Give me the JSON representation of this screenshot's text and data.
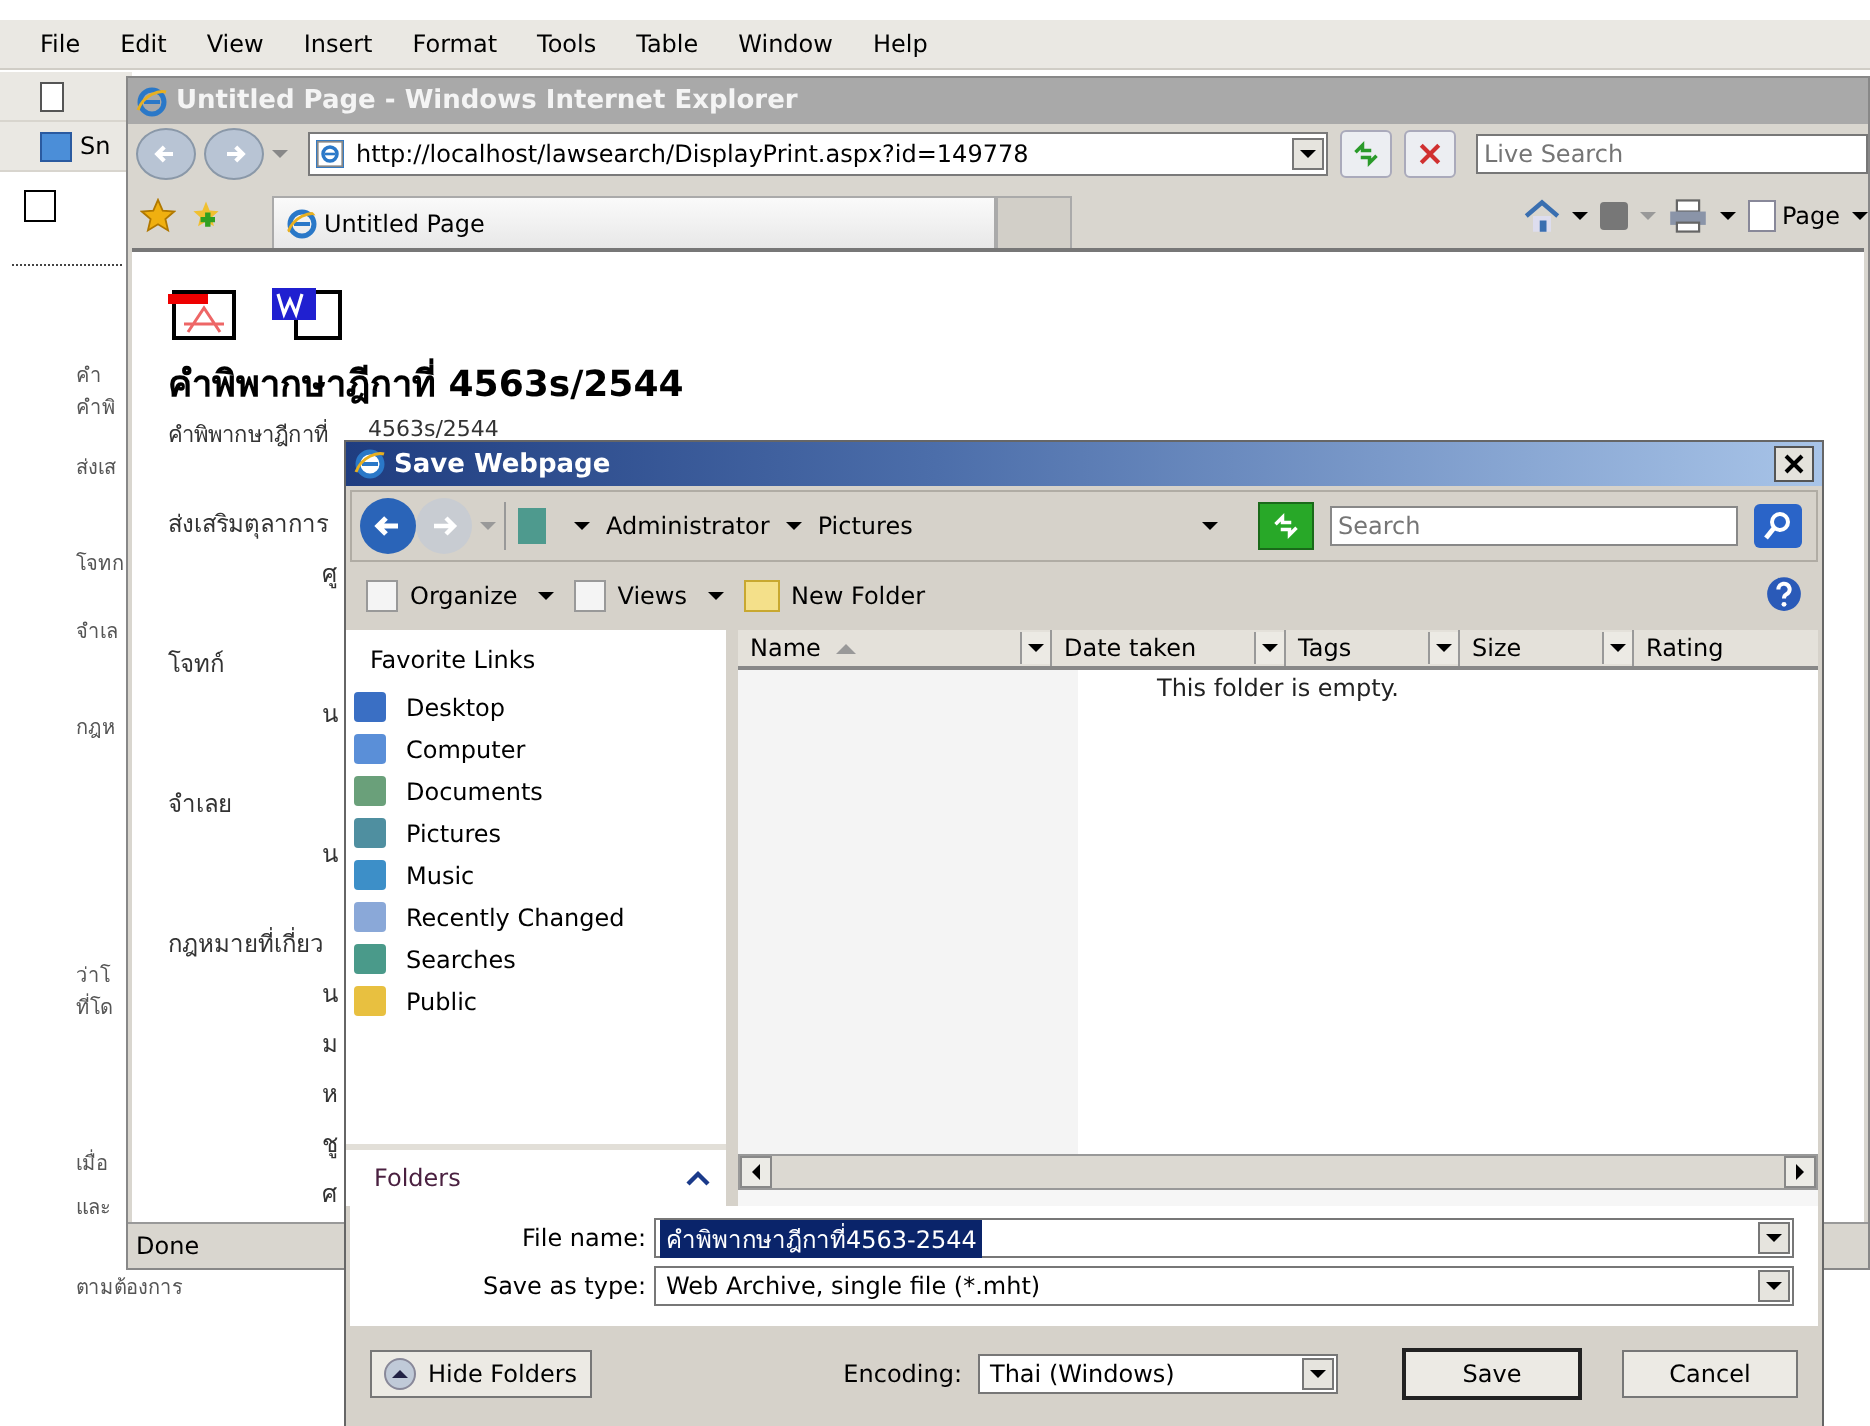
{
  "word": {
    "menu": [
      "File",
      "Edit",
      "View",
      "Insert",
      "Format",
      "Tools",
      "Table",
      "Window",
      "Help"
    ],
    "toolbar_label": "Sn",
    "document_fragments": [
      "คำ",
      "คำพิ",
      "ส่งเส",
      "โจทก",
      "จำเล",
      "กฎห",
      "ว่าโ",
      "ที่โด",
      "เมื่อ",
      "และ",
      "ตามต้องการ"
    ]
  },
  "browser": {
    "title": "Untitled Page - Windows Internet Explorer",
    "url": "http://localhost/lawsearch/DisplayPrint.aspx?id=149778",
    "search": {
      "placeholder": "Live Search"
    },
    "tabs": [
      {
        "label": "Untitled Page",
        "selected": true
      }
    ],
    "command_bar": {
      "page": "Page"
    },
    "page": {
      "heading": "คำพิพากษาฎีกาที่ 4563s/2544",
      "lines": [
        {
          "kind": "field",
          "label": "คำพิพากษาฎีกาที่",
          "value": "4563s/2544"
        },
        {
          "kind": "label",
          "text": "ส่งเสริมตุลาการ"
        },
        {
          "kind": "indent",
          "text": "ศู"
        },
        {
          "kind": "label",
          "text": "โจทก์"
        },
        {
          "kind": "indent",
          "text": "น"
        },
        {
          "kind": "label",
          "text": "จำเลย"
        },
        {
          "kind": "indent",
          "text": "น"
        },
        {
          "kind": "label",
          "text": "กฎหมายที่เกี่ยว"
        },
        {
          "kind": "indent",
          "text": "น"
        },
        {
          "kind": "indent",
          "text": "ม"
        },
        {
          "kind": "indent",
          "text": "ห"
        },
        {
          "kind": "indent",
          "text": "ชู"
        },
        {
          "kind": "indent",
          "text": "ศ"
        }
      ]
    },
    "status": "Done"
  },
  "dialog": {
    "title": "Save Webpage",
    "breadcrumb": [
      "Administrator",
      "Pictures"
    ],
    "search": {
      "placeholder": "Search"
    },
    "toolbar": [
      "Organize",
      "Views",
      "New Folder"
    ],
    "favorites_title": "Favorite Links",
    "favorites": [
      "Desktop",
      "Computer",
      "Documents",
      "Pictures",
      "Music",
      "Recently Changed",
      "Searches",
      "Public"
    ],
    "folders_label": "Folders",
    "columns": [
      "Name",
      "Date taken",
      "Tags",
      "Size",
      "Rating"
    ],
    "empty_message": "This folder is empty.",
    "file_name": {
      "label": "File name:",
      "value": "คำพิพากษาฎีกาที่4563-2544",
      "selected": true
    },
    "save_as_type": {
      "label": "Save as type:",
      "value": "Web Archive, single file (*.mht)"
    },
    "hide_folders": "Hide Folders",
    "encoding": {
      "label": "Encoding:",
      "value": "Thai (Windows)"
    },
    "buttons": [
      "Save",
      "Cancel"
    ]
  }
}
